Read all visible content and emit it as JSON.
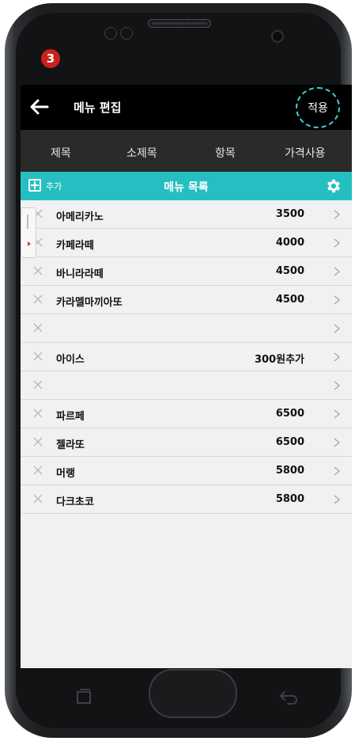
{
  "step_badge": "3",
  "appbar": {
    "title": "메뉴 편집",
    "apply_label": "적용"
  },
  "tabs": [
    "제목",
    "소제목",
    "항목",
    "가격사용"
  ],
  "list_header": {
    "add_label": "추가",
    "title": "메뉴 목록"
  },
  "menu_items": [
    {
      "name": "아메리카노",
      "price": "3500"
    },
    {
      "name": "카페라떼",
      "price": "4000"
    },
    {
      "name": "바니라라떼",
      "price": "4500"
    },
    {
      "name": "카라멜마끼아또",
      "price": "4500"
    },
    {
      "name": "",
      "price": ""
    },
    {
      "name": "아이스",
      "price": "300원추가"
    },
    {
      "name": "",
      "price": ""
    },
    {
      "name": "파르페",
      "price": "6500"
    },
    {
      "name": "젤라또",
      "price": "6500"
    },
    {
      "name": "머랭",
      "price": "5800"
    },
    {
      "name": "다크초코",
      "price": "5800"
    }
  ],
  "colors": {
    "accent": "#26bfc1",
    "appbar": "#000000",
    "tabbar": "#2a2a2a",
    "badge": "#c8221b"
  },
  "icons": [
    "back-arrow-icon",
    "add-icon",
    "gear-icon",
    "delete-x-icon",
    "chevron-right-icon",
    "recent-apps-icon",
    "nav-back-icon"
  ]
}
